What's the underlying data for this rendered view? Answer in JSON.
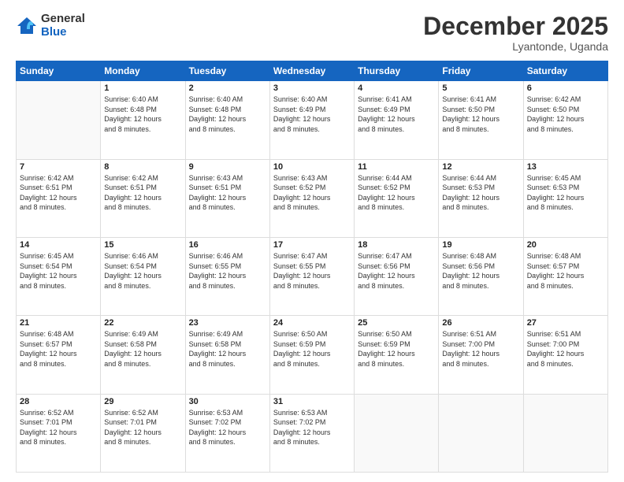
{
  "logo": {
    "general": "General",
    "blue": "Blue"
  },
  "header": {
    "title": "December 2025",
    "subtitle": "Lyantonde, Uganda"
  },
  "days_of_week": [
    "Sunday",
    "Monday",
    "Tuesday",
    "Wednesday",
    "Thursday",
    "Friday",
    "Saturday"
  ],
  "weeks": [
    [
      {
        "day": "",
        "info": ""
      },
      {
        "day": "1",
        "info": "Sunrise: 6:40 AM\nSunset: 6:48 PM\nDaylight: 12 hours\nand 8 minutes."
      },
      {
        "day": "2",
        "info": "Sunrise: 6:40 AM\nSunset: 6:48 PM\nDaylight: 12 hours\nand 8 minutes."
      },
      {
        "day": "3",
        "info": "Sunrise: 6:40 AM\nSunset: 6:49 PM\nDaylight: 12 hours\nand 8 minutes."
      },
      {
        "day": "4",
        "info": "Sunrise: 6:41 AM\nSunset: 6:49 PM\nDaylight: 12 hours\nand 8 minutes."
      },
      {
        "day": "5",
        "info": "Sunrise: 6:41 AM\nSunset: 6:50 PM\nDaylight: 12 hours\nand 8 minutes."
      },
      {
        "day": "6",
        "info": "Sunrise: 6:42 AM\nSunset: 6:50 PM\nDaylight: 12 hours\nand 8 minutes."
      }
    ],
    [
      {
        "day": "7",
        "info": "Sunrise: 6:42 AM\nSunset: 6:51 PM\nDaylight: 12 hours\nand 8 minutes."
      },
      {
        "day": "8",
        "info": "Sunrise: 6:42 AM\nSunset: 6:51 PM\nDaylight: 12 hours\nand 8 minutes."
      },
      {
        "day": "9",
        "info": "Sunrise: 6:43 AM\nSunset: 6:51 PM\nDaylight: 12 hours\nand 8 minutes."
      },
      {
        "day": "10",
        "info": "Sunrise: 6:43 AM\nSunset: 6:52 PM\nDaylight: 12 hours\nand 8 minutes."
      },
      {
        "day": "11",
        "info": "Sunrise: 6:44 AM\nSunset: 6:52 PM\nDaylight: 12 hours\nand 8 minutes."
      },
      {
        "day": "12",
        "info": "Sunrise: 6:44 AM\nSunset: 6:53 PM\nDaylight: 12 hours\nand 8 minutes."
      },
      {
        "day": "13",
        "info": "Sunrise: 6:45 AM\nSunset: 6:53 PM\nDaylight: 12 hours\nand 8 minutes."
      }
    ],
    [
      {
        "day": "14",
        "info": "Sunrise: 6:45 AM\nSunset: 6:54 PM\nDaylight: 12 hours\nand 8 minutes."
      },
      {
        "day": "15",
        "info": "Sunrise: 6:46 AM\nSunset: 6:54 PM\nDaylight: 12 hours\nand 8 minutes."
      },
      {
        "day": "16",
        "info": "Sunrise: 6:46 AM\nSunset: 6:55 PM\nDaylight: 12 hours\nand 8 minutes."
      },
      {
        "day": "17",
        "info": "Sunrise: 6:47 AM\nSunset: 6:55 PM\nDaylight: 12 hours\nand 8 minutes."
      },
      {
        "day": "18",
        "info": "Sunrise: 6:47 AM\nSunset: 6:56 PM\nDaylight: 12 hours\nand 8 minutes."
      },
      {
        "day": "19",
        "info": "Sunrise: 6:48 AM\nSunset: 6:56 PM\nDaylight: 12 hours\nand 8 minutes."
      },
      {
        "day": "20",
        "info": "Sunrise: 6:48 AM\nSunset: 6:57 PM\nDaylight: 12 hours\nand 8 minutes."
      }
    ],
    [
      {
        "day": "21",
        "info": "Sunrise: 6:48 AM\nSunset: 6:57 PM\nDaylight: 12 hours\nand 8 minutes."
      },
      {
        "day": "22",
        "info": "Sunrise: 6:49 AM\nSunset: 6:58 PM\nDaylight: 12 hours\nand 8 minutes."
      },
      {
        "day": "23",
        "info": "Sunrise: 6:49 AM\nSunset: 6:58 PM\nDaylight: 12 hours\nand 8 minutes."
      },
      {
        "day": "24",
        "info": "Sunrise: 6:50 AM\nSunset: 6:59 PM\nDaylight: 12 hours\nand 8 minutes."
      },
      {
        "day": "25",
        "info": "Sunrise: 6:50 AM\nSunset: 6:59 PM\nDaylight: 12 hours\nand 8 minutes."
      },
      {
        "day": "26",
        "info": "Sunrise: 6:51 AM\nSunset: 7:00 PM\nDaylight: 12 hours\nand 8 minutes."
      },
      {
        "day": "27",
        "info": "Sunrise: 6:51 AM\nSunset: 7:00 PM\nDaylight: 12 hours\nand 8 minutes."
      }
    ],
    [
      {
        "day": "28",
        "info": "Sunrise: 6:52 AM\nSunset: 7:01 PM\nDaylight: 12 hours\nand 8 minutes."
      },
      {
        "day": "29",
        "info": "Sunrise: 6:52 AM\nSunset: 7:01 PM\nDaylight: 12 hours\nand 8 minutes."
      },
      {
        "day": "30",
        "info": "Sunrise: 6:53 AM\nSunset: 7:02 PM\nDaylight: 12 hours\nand 8 minutes."
      },
      {
        "day": "31",
        "info": "Sunrise: 6:53 AM\nSunset: 7:02 PM\nDaylight: 12 hours\nand 8 minutes."
      },
      {
        "day": "",
        "info": ""
      },
      {
        "day": "",
        "info": ""
      },
      {
        "day": "",
        "info": ""
      }
    ]
  ]
}
